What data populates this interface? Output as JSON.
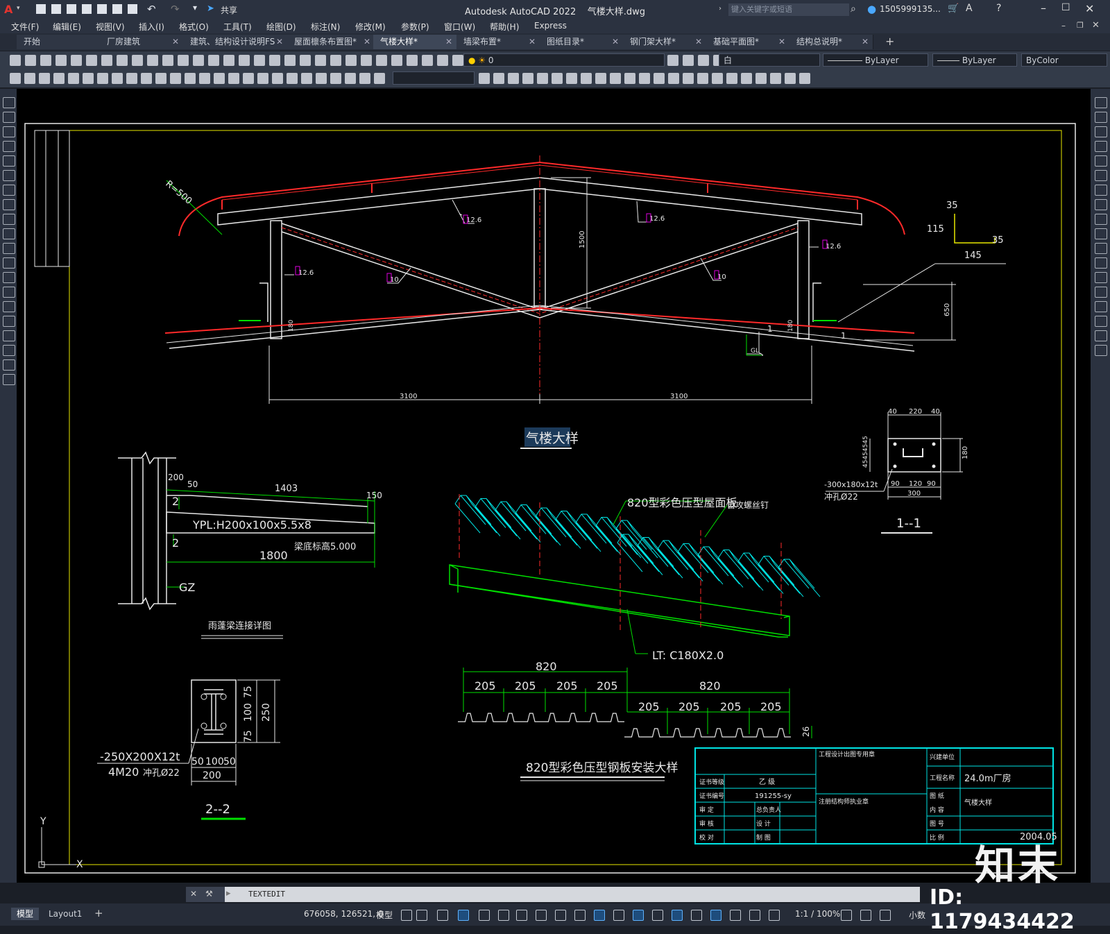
{
  "app": {
    "title": "Autodesk AutoCAD 2022",
    "file": "气楼大样.dwg",
    "share_label": "共享",
    "search_placeholder": "键入关键字或短语",
    "user": "1505999135...",
    "window_controls": [
      "minimize-icon",
      "maximize-icon",
      "close-icon"
    ]
  },
  "menu": [
    "文件(F)",
    "编辑(E)",
    "视图(V)",
    "插入(I)",
    "格式(O)",
    "工具(T)",
    "绘图(D)",
    "标注(N)",
    "修改(M)",
    "参数(P)",
    "窗口(W)",
    "帮助(H)",
    "Express"
  ],
  "tabs": [
    {
      "label": "开始",
      "active": false,
      "closable": false
    },
    {
      "label": "厂房建筑",
      "active": false,
      "closable": true
    },
    {
      "label": "建筑、结构设计说明FS",
      "active": false,
      "closable": true
    },
    {
      "label": "屋面檩条布置图*",
      "active": false,
      "closable": true
    },
    {
      "label": "气楼大样*",
      "active": true,
      "closable": true
    },
    {
      "label": "墙梁布置*",
      "active": false,
      "closable": true
    },
    {
      "label": "图纸目录*",
      "active": false,
      "closable": true
    },
    {
      "label": "钢门架大样*",
      "active": false,
      "closable": true
    },
    {
      "label": "基础平面图*",
      "active": false,
      "closable": true
    },
    {
      "label": "结构总说明*",
      "active": false,
      "closable": true
    }
  ],
  "properties": {
    "layer": "0",
    "color": "白",
    "linetype1": "ByLayer",
    "linetype2": "ByLayer",
    "lineweight": "ByColor"
  },
  "drawing": {
    "main_title": "气楼大样",
    "radius_label": "R=500",
    "channel_labels": [
      "12.6",
      "12.6",
      "12.6",
      "12.6",
      "10",
      "10"
    ],
    "dim_1500": "1500",
    "dim_3100_left": "3100",
    "dim_3100_right": "3100",
    "dim_650": "650",
    "dim_180a": "180",
    "dim_180b": "180",
    "slope_1a": "1",
    "slope_1b": "1",
    "gl_label": "GL",
    "angle_dims": [
      "35",
      "115",
      "35",
      "145"
    ],
    "section11": {
      "title": "1--1",
      "top_dims": [
        "40",
        "220",
        "40"
      ],
      "bottom_dims": [
        "90",
        "120",
        "90"
      ],
      "bottom_total": "300",
      "side_dim": "180",
      "left_dims": "45454545",
      "plate": "-300x180x12t",
      "hole": "冲孔Ø22"
    },
    "canopy": {
      "title": "雨蓬梁连接详图",
      "dims": [
        "200",
        "50",
        "1403",
        "150",
        "1800"
      ],
      "weld1": "2",
      "weld2": "2",
      "beam": "YPL:H200x100x5.5x8",
      "elev": "梁底标高5.000",
      "column": "GZ"
    },
    "section22": {
      "title": "2--2",
      "plate": "-250X200X12t",
      "bolts": "4M20",
      "hole": "冲孔Ø22",
      "vdims": [
        "75",
        "100",
        "75",
        "250"
      ],
      "hdims": [
        "50",
        "100",
        "50",
        "200"
      ]
    },
    "panel": {
      "label": "820型彩色压型屋面板",
      "screw": "自攻螺丝钉",
      "purlin": "LT: C180X2.0",
      "title": "820型彩色压型钢板安装大样",
      "top_total": "820",
      "top_dims": [
        "205",
        "205",
        "205",
        "205"
      ],
      "bot_total": "820",
      "bot_dims": [
        "205",
        "205",
        "205",
        "205"
      ],
      "height": "26"
    },
    "titleblock": {
      "design_cert": "工程设计出图专用章",
      "grade_label": "证书等级",
      "grade": "乙 级",
      "cert_label": "证书编号",
      "cert_no": "191255-sy",
      "review": "审 定",
      "chief": "总负责人",
      "check": "审 核",
      "design": "设 计",
      "proof": "校 对",
      "draw": "制 图",
      "reg": "注册结构师执业章",
      "client_label": "兴建单位",
      "project_label": "工程名称",
      "project": "24.0m厂房",
      "drawing_label": "图 纸",
      "content_label": "内 容",
      "content": "气楼大样",
      "sheet_label": "图 号",
      "date_label": "比 例",
      "date": "2004.05"
    },
    "ucs": {
      "x": "X",
      "y": "Y"
    }
  },
  "command": {
    "text": "TEXTEDIT"
  },
  "status": {
    "model_tab": "模型",
    "layout_tab": "Layout1",
    "coords": "676058, 126521, 0",
    "model_btn": "模型",
    "scale": "1:1 / 100%",
    "units": "小数"
  },
  "watermark": {
    "id": "ID: 1179434422",
    "logo": "知末"
  },
  "colors": {
    "red": "#ff2a2a",
    "white": "#e8e8e8",
    "green": "#00e000",
    "cyan": "#00e5e5",
    "yellow": "#e8e800",
    "magenta": "#e000e0"
  }
}
